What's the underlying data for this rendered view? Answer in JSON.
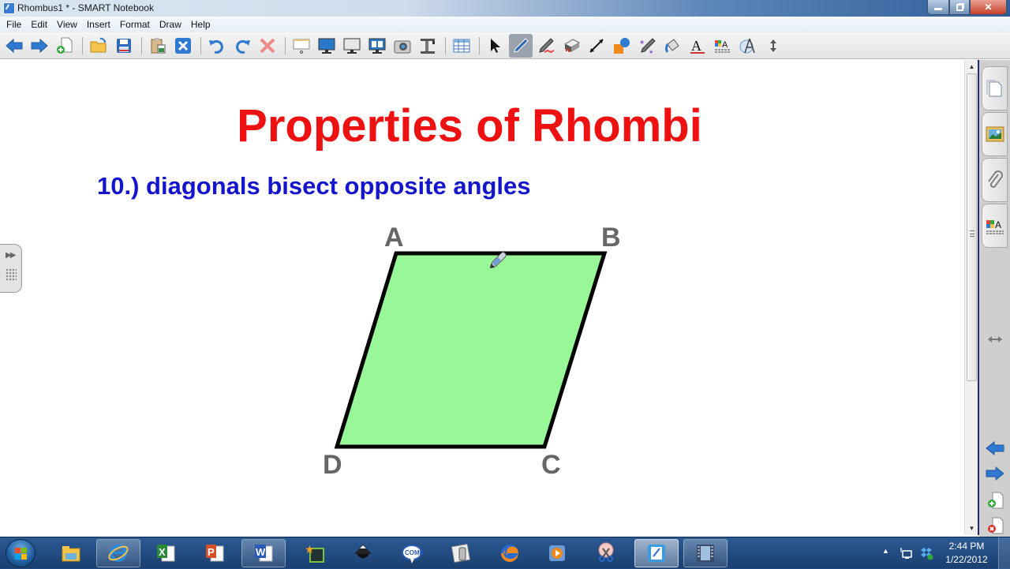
{
  "window": {
    "title": "Rhombus1 * - SMART Notebook",
    "controls": {
      "minimize": "minimize",
      "restore": "restore",
      "close": "close"
    }
  },
  "menu": {
    "items": [
      "File",
      "Edit",
      "View",
      "Insert",
      "Format",
      "Draw",
      "Help"
    ]
  },
  "toolbar": {
    "buttons": [
      {
        "id": "previous-page",
        "icon": "arrow-left-icon"
      },
      {
        "id": "next-page",
        "icon": "arrow-right-icon"
      },
      {
        "id": "add-page",
        "icon": "add-page-icon"
      },
      {
        "id": "open-file",
        "icon": "folder-open-icon"
      },
      {
        "id": "save",
        "icon": "save-icon"
      },
      {
        "id": "paste",
        "icon": "paste-icon"
      },
      {
        "id": "full-screen-toggle",
        "icon": "close-x-icon"
      },
      {
        "id": "undo",
        "icon": "undo-icon"
      },
      {
        "id": "redo",
        "icon": "redo-icon"
      },
      {
        "id": "delete",
        "icon": "delete-icon"
      },
      {
        "id": "screen-shade",
        "icon": "screen-shade-icon"
      },
      {
        "id": "full-screen",
        "icon": "full-screen-icon"
      },
      {
        "id": "transparent-background",
        "icon": "transparent-screen-icon"
      },
      {
        "id": "dual-page",
        "icon": "dual-page-icon"
      },
      {
        "id": "screen-capture",
        "icon": "camera-icon"
      },
      {
        "id": "document-camera",
        "icon": "document-camera-icon"
      },
      {
        "id": "insert-table",
        "icon": "table-icon"
      },
      {
        "id": "select",
        "icon": "pointer-icon"
      },
      {
        "id": "pen",
        "icon": "pen-icon",
        "active": true
      },
      {
        "id": "creative-pen",
        "icon": "creative-pen-icon"
      },
      {
        "id": "eraser",
        "icon": "eraser-icon"
      },
      {
        "id": "line",
        "icon": "line-icon"
      },
      {
        "id": "shapes",
        "icon": "shapes-icon"
      },
      {
        "id": "magic-pen",
        "icon": "magic-pen-icon"
      },
      {
        "id": "fill",
        "icon": "fill-bucket-icon"
      },
      {
        "id": "text",
        "icon": "text-icon"
      },
      {
        "id": "properties",
        "icon": "properties-icon"
      },
      {
        "id": "measurement-tools",
        "icon": "compass-icon"
      },
      {
        "id": "move-toolbar",
        "icon": "move-vertical-icon"
      }
    ]
  },
  "slide": {
    "title": "Properties of Rhombi",
    "subtitle": "10.) diagonals bisect opposite angles",
    "colors": {
      "title": "#ee1111",
      "subtitle": "#1414cc",
      "fill": "#98f898",
      "stroke": "#000000",
      "labels": "#666666"
    },
    "vertices": [
      {
        "label": "A"
      },
      {
        "label": "B"
      },
      {
        "label": "C"
      },
      {
        "label": "D"
      }
    ]
  },
  "sidepanel": {
    "tabs": [
      {
        "id": "page-sorter",
        "icon": "page-sorter-icon"
      },
      {
        "id": "gallery",
        "icon": "gallery-icon"
      },
      {
        "id": "attachments",
        "icon": "paperclip-icon"
      },
      {
        "id": "properties",
        "icon": "properties-icon"
      }
    ],
    "controls": [
      {
        "id": "move-sidebar",
        "icon": "move-horizontal-icon"
      },
      {
        "id": "previous-page",
        "icon": "arrow-left-icon"
      },
      {
        "id": "next-page",
        "icon": "arrow-right-icon"
      },
      {
        "id": "add-page",
        "icon": "add-page-icon"
      },
      {
        "id": "delete-page",
        "icon": "delete-page-icon"
      }
    ]
  },
  "taskbar": {
    "apps": [
      {
        "name": "Windows Explorer",
        "icon": "explorer-icon",
        "state": "pinned"
      },
      {
        "name": "Internet Explorer",
        "icon": "internet-explorer-icon",
        "state": "open"
      },
      {
        "name": "Excel",
        "icon": "excel-icon",
        "state": "pinned"
      },
      {
        "name": "PowerPoint",
        "icon": "powerpoint-icon",
        "state": "pinned"
      },
      {
        "name": "Word",
        "icon": "word-icon",
        "state": "open"
      },
      {
        "name": "Smart Gallery",
        "icon": "gallery-star-icon",
        "state": "pinned"
      },
      {
        "name": "Inkscape",
        "icon": "inkscape-icon",
        "state": "pinned"
      },
      {
        "name": "Comic Life",
        "icon": "comic-life-icon",
        "state": "pinned"
      },
      {
        "name": "Phone Tools",
        "icon": "phone-tools-icon",
        "state": "pinned"
      },
      {
        "name": "Firefox",
        "icon": "firefox-icon",
        "state": "pinned"
      },
      {
        "name": "Media Player",
        "icon": "media-player-icon",
        "state": "pinned"
      },
      {
        "name": "Snipping Tool",
        "icon": "snipping-tool-icon",
        "state": "pinned"
      },
      {
        "name": "SMART Notebook",
        "icon": "notebook-icon",
        "state": "active"
      },
      {
        "name": "Video Recorder",
        "icon": "film-icon",
        "state": "open"
      }
    ],
    "tray": {
      "time": "2:44 PM",
      "date": "1/22/2012"
    }
  }
}
